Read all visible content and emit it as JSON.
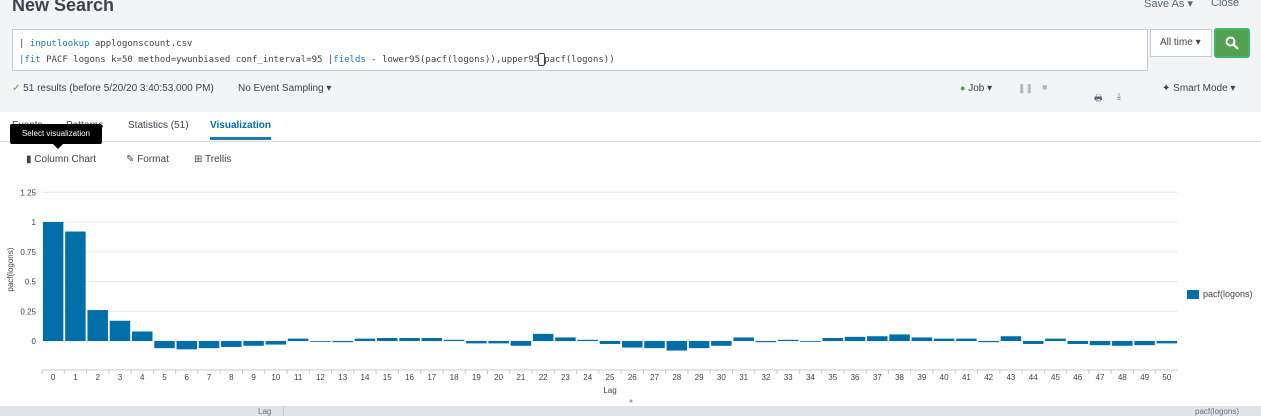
{
  "header": {
    "title": "New Search",
    "save_as_label": "Save As",
    "close_label": "Close"
  },
  "search": {
    "line1_pipe": "| ",
    "line1_command": "inputlookup",
    "line1_rest": " applogonscount.csv",
    "line2_pipe": "|",
    "line2_command": "fit",
    "line2_mid": " PACF logons k=50 method=ywunbiased conf_interval=95 |",
    "line2_command2": "fields",
    "line2_rest_a": " - lower95(pacf(logons)),upper95",
    "line2_rest_b": "pacf(logons))",
    "time_range": "All time",
    "search_icon": "magnifier-icon"
  },
  "status": {
    "results": "51 results (before 5/20/20 3:40:53.000 PM)",
    "sampling": "No Event Sampling",
    "job": "Job",
    "mode": "Smart Mode",
    "accent_color": "#53a051"
  },
  "tabs": {
    "events": "Events",
    "patterns": "Patterns",
    "statistics": "Statistics (51)",
    "visualization": "Visualization"
  },
  "tooltip": "Select visualization",
  "viz_toolbar": {
    "chart_type": "Column Chart",
    "format": "Format",
    "trellis": "Trellis"
  },
  "footer": {
    "col1": "Lag",
    "col2": "pacf(logons)"
  },
  "chart_data": {
    "type": "bar",
    "xlabel": "Lag",
    "ylabel": "pacf(logons)",
    "ylim": [
      -0.05,
      1.25
    ],
    "yticks": [
      "1.25",
      "1",
      "0.75",
      "0.5",
      "0.25",
      "0"
    ],
    "grid": true,
    "legend_position": "right",
    "color": "#006ea8",
    "categories": [
      "0",
      "1",
      "2",
      "3",
      "4",
      "5",
      "6",
      "7",
      "8",
      "9",
      "10",
      "11",
      "12",
      "13",
      "14",
      "15",
      "16",
      "17",
      "18",
      "19",
      "20",
      "21",
      "22",
      "23",
      "24",
      "25",
      "26",
      "27",
      "28",
      "29",
      "30",
      "31",
      "32",
      "33",
      "34",
      "35",
      "36",
      "37",
      "38",
      "39",
      "40",
      "41",
      "42",
      "43",
      "44",
      "45",
      "46",
      "47",
      "48",
      "49",
      "50"
    ],
    "series": [
      {
        "name": "pacf(logons)",
        "values": [
          1.0,
          0.92,
          0.26,
          0.17,
          0.08,
          -0.06,
          -0.07,
          -0.06,
          -0.05,
          -0.04,
          -0.03,
          0.02,
          -0.005,
          -0.01,
          0.02,
          0.025,
          0.025,
          0.025,
          0.01,
          -0.02,
          -0.02,
          -0.04,
          0.06,
          0.03,
          0.01,
          -0.025,
          -0.055,
          -0.06,
          -0.08,
          -0.06,
          -0.04,
          0.03,
          -0.01,
          0.01,
          -0.005,
          0.025,
          0.035,
          0.04,
          0.055,
          0.03,
          0.02,
          0.02,
          -0.01,
          0.04,
          -0.025,
          0.02,
          -0.025,
          -0.035,
          -0.04,
          -0.035,
          -0.02
        ]
      }
    ]
  }
}
